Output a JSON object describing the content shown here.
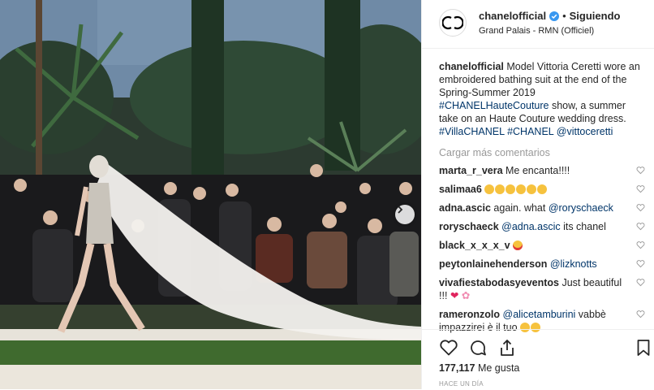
{
  "header": {
    "username": "chanelofficial",
    "separator": "•",
    "follow_label": "Siguiendo",
    "location": "Grand Palais - RMN (Officiel)"
  },
  "caption": {
    "username": "chanelofficial",
    "text_1": " Model Vittoria Ceretti wore an embroidered bathing suit at the end of the Spring-Summer 2019 ",
    "tag_1": "#CHANELHauteCouture",
    "text_2": " show, a summer take on an Haute Couture wedding dress. ",
    "tag_2": "#VillaCHANEL",
    "tag_3": "#CHANEL",
    "tag_4": "@vittoceretti"
  },
  "load_more_label": "Cargar más comentarios",
  "comments": [
    {
      "user": "marta_r_vera",
      "text": " Me encanta!!!!"
    },
    {
      "user": "salimaa6",
      "text": ""
    },
    {
      "user": "adna.ascic",
      "text": " again. what ",
      "mention": "@roryschaeck"
    },
    {
      "user": "roryschaeck",
      "mention": "@adna.ascic",
      "text": " its chanel"
    },
    {
      "user": "black_x_x_x_v",
      "text": ""
    },
    {
      "user": "peytonlainehenderson",
      "mention": "@lizknotts"
    },
    {
      "user": "vivafiestabodasyeventos",
      "text": " Just beautiful !!!"
    },
    {
      "user": "rameronzolo",
      "mention": "@alicetamburini",
      "text": " vabbè impazzirei è il tuo"
    }
  ],
  "likes": {
    "count": "177,117",
    "label": " Me gusta"
  },
  "timestamp": "HACE UN DÍA",
  "icons": [
    "heart-icon",
    "comment-icon",
    "share-icon",
    "bookmark-icon",
    "next-arrow-icon",
    "verified-badge-icon",
    "chanel-logo"
  ],
  "colors": {
    "link": "#003569",
    "muted": "#999999",
    "verified": "#3897f0"
  }
}
